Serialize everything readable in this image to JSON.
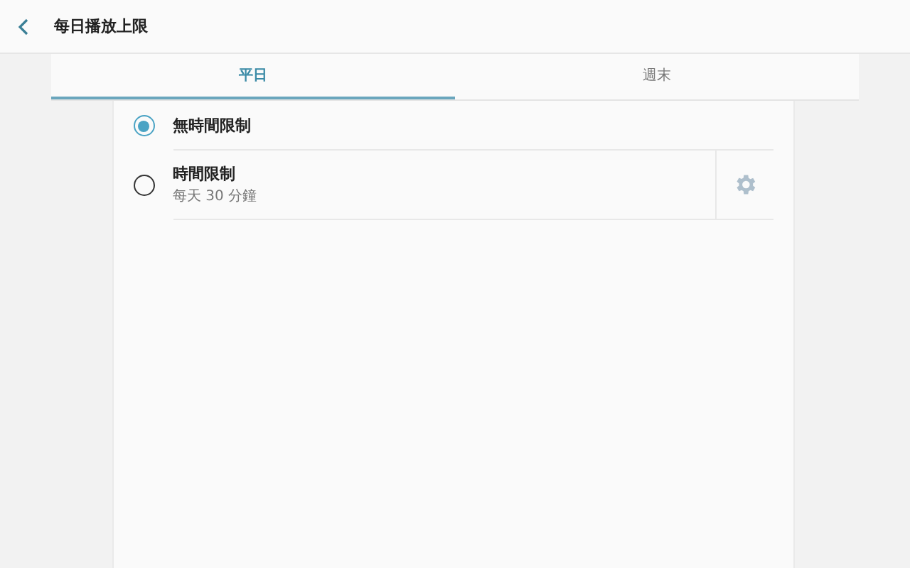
{
  "header": {
    "title": "每日播放上限"
  },
  "tabs": [
    {
      "label": "平日",
      "selected": true
    },
    {
      "label": "週末",
      "selected": false
    }
  ],
  "options": [
    {
      "label": "無時間限制",
      "selected": true,
      "has_settings": false
    },
    {
      "label": "時間限制",
      "sublabel": "每天 30 分鐘",
      "selected": false,
      "has_settings": true
    }
  ]
}
